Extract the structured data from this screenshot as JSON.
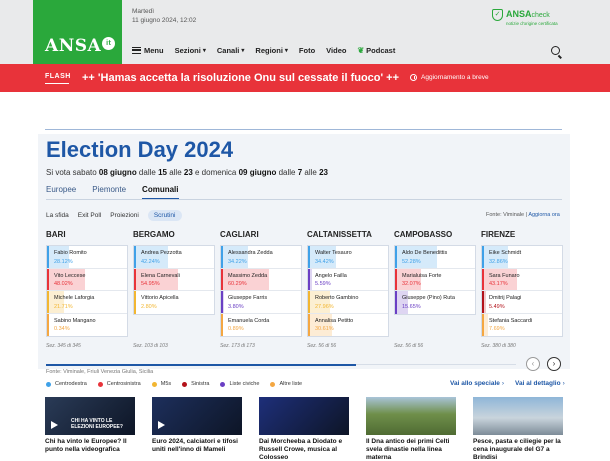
{
  "header": {
    "date_line1": "Martedì",
    "date_line2": "11 giugno 2024, 12:02",
    "logo_text": "ANSA",
    "logo_suffix": "it",
    "ansacheck_brand": "ANSA",
    "ansacheck_word": "check",
    "ansacheck_tagline": "notizie d'origine certificata",
    "nav": {
      "menu": "Menu",
      "sezioni": "Sezioni",
      "canali": "Canali",
      "regioni": "Regioni",
      "foto": "Foto",
      "video": "Video",
      "podcast": "Podcast"
    }
  },
  "flash": {
    "label": "FLASH",
    "text": "++ 'Hamas accetta la risoluzione Onu sul cessate il fuoco' ++",
    "update": "Aggiornamento a breve"
  },
  "election": {
    "title": "Election Day 2024",
    "subtitle_parts": [
      "Si vota sabato ",
      "08 giugno",
      " dalle ",
      "15",
      " alle ",
      "23",
      " e domenica ",
      "09 giugno",
      " dalle ",
      "7",
      " alle ",
      "23"
    ],
    "tabs": [
      "Europee",
      "Piemonte",
      "Comunali"
    ],
    "active_tab": 2,
    "subtabs": [
      "La sfida",
      "Exit Poll",
      "Proiezioni",
      "Scrutini"
    ],
    "active_subtab": 3,
    "source_label": "Fonte: Viminale",
    "source_link": "Aggiorna ora",
    "footer_source": "Fonte: Viminale, Friuli Venezia Giulia, Sicilia",
    "progress": 0.66,
    "cities": [
      {
        "name": "BARI",
        "sezioni": "Sez. 345 di 345",
        "candidates": [
          {
            "name": "Fabio Romito",
            "pct": "28.12%",
            "value": 28.12,
            "coalition": "centrodestra"
          },
          {
            "name": "Vito Leccese",
            "pct": "48.02%",
            "value": 48.02,
            "coalition": "centrosinistra"
          },
          {
            "name": "Michele Laforgia",
            "pct": "21.71%",
            "value": 21.71,
            "coalition": "m5s"
          },
          {
            "name": "Sabino Mangano",
            "pct": "0.34%",
            "value": 0.34,
            "coalition": "altre"
          }
        ]
      },
      {
        "name": "BERGAMO",
        "sezioni": "Sez. 103 di 103",
        "candidates": [
          {
            "name": "Andrea Pezzotta",
            "pct": "42.24%",
            "value": 42.24,
            "coalition": "centrodestra"
          },
          {
            "name": "Elena Carnevali",
            "pct": "54.95%",
            "value": 54.95,
            "coalition": "centrosinistra"
          },
          {
            "name": "Vittorio Apicella",
            "pct": "2.80%",
            "value": 2.8,
            "coalition": "m5s"
          }
        ]
      },
      {
        "name": "CAGLIARI",
        "sezioni": "Sez. 173 di 173",
        "candidates": [
          {
            "name": "Alessandra Zedda",
            "pct": "34.22%",
            "value": 34.22,
            "coalition": "centrodestra"
          },
          {
            "name": "Massimo Zedda",
            "pct": "60.29%",
            "value": 60.29,
            "coalition": "centrosinistra"
          },
          {
            "name": "Giuseppe Farris",
            "pct": "3.80%",
            "value": 3.8,
            "coalition": "liste_civiche"
          },
          {
            "name": "Emanuela Corda",
            "pct": "0.89%",
            "value": 0.89,
            "coalition": "altre"
          }
        ]
      },
      {
        "name": "CALTANISSETTA",
        "sezioni": "Sez. 56 di 56",
        "candidates": [
          {
            "name": "Walter Tesauro",
            "pct": "34.42%",
            "value": 34.42,
            "coalition": "centrodestra"
          },
          {
            "name": "Angelo Failla",
            "pct": "5.59%",
            "value": 5.59,
            "coalition": "liste_civiche"
          },
          {
            "name": "Roberto Gambino",
            "pct": "27.96%",
            "value": 27.96,
            "coalition": "m5s"
          },
          {
            "name": "Annalisa Petitto",
            "pct": "30.61%",
            "value": 30.61,
            "coalition": "altre"
          }
        ]
      },
      {
        "name": "CAMPOBASSO",
        "sezioni": "Sez. 56 di 56",
        "candidates": [
          {
            "name": "Aldo De Benedittis",
            "pct": "52.28%",
            "value": 52.28,
            "coalition": "centrodestra"
          },
          {
            "name": "Marialuisa Forte",
            "pct": "32.07%",
            "value": 32.07,
            "coalition": "centrosinistra"
          },
          {
            "name": "Giuseppe (Pino) Ruta",
            "pct": "15.65%",
            "value": 15.65,
            "coalition": "liste_civiche"
          }
        ]
      },
      {
        "name": "FIRENZE",
        "sezioni": "Sez. 380 di 380",
        "candidates": [
          {
            "name": "Eike Schmidt",
            "pct": "32.86%",
            "value": 32.86,
            "coalition": "centrodestra"
          },
          {
            "name": "Sara Funaro",
            "pct": "43.17%",
            "value": 43.17,
            "coalition": "centrosinistra"
          },
          {
            "name": "Dmitrij Palagi",
            "pct": "5.49%",
            "value": 5.49,
            "coalition": "sinistra"
          },
          {
            "name": "Stefania Saccardi",
            "pct": "7.69%",
            "value": 7.69,
            "coalition": "altre"
          }
        ]
      }
    ],
    "legend": [
      {
        "key": "centrodestra",
        "label": "Centrodestra",
        "color": "#3fa1e8"
      },
      {
        "key": "centrosinistra",
        "label": "Centrosinistra",
        "color": "#e8333a"
      },
      {
        "key": "m5s",
        "label": "M5s",
        "color": "#f2b632"
      },
      {
        "key": "sinistra",
        "label": "Sinistra",
        "color": "#b3121a"
      },
      {
        "key": "liste_civiche",
        "label": "Liste civiche",
        "color": "#6a3fc4"
      },
      {
        "key": "altre",
        "label": "Altre liste",
        "color": "#f4a742"
      }
    ],
    "links": {
      "speciale": "Vai allo speciale",
      "dettaglio": "Vai al dettaglio"
    }
  },
  "thumbs": [
    {
      "caption": "Chi ha vinto le Europee? Il punto nella videografica",
      "overlay": "CHI HA VINTO LE ELEZIONI EUROPEE?",
      "video": true,
      "bg": "#2a3b57"
    },
    {
      "caption": "Euro 2024, calciatori e tifosi uniti nell'inno di Mameli",
      "overlay": "",
      "video": true,
      "bg": "#1d2f5c"
    },
    {
      "caption": "Dai Morcheeba a Diodato e Russell Crowe, musica al Colosseo",
      "overlay": "",
      "video": false,
      "bg": "#1e2f7a"
    },
    {
      "caption": "Il Dna antico dei primi Celti svela dinastie nella linea materna",
      "overlay": "",
      "video": false,
      "bg": "#6f8f4a"
    },
    {
      "caption": "Pesce, pasta e ciliegie per la cena inaugurale del G7 a Brindisi",
      "overlay": "",
      "video": false,
      "bg": "#8fb6d8"
    }
  ]
}
